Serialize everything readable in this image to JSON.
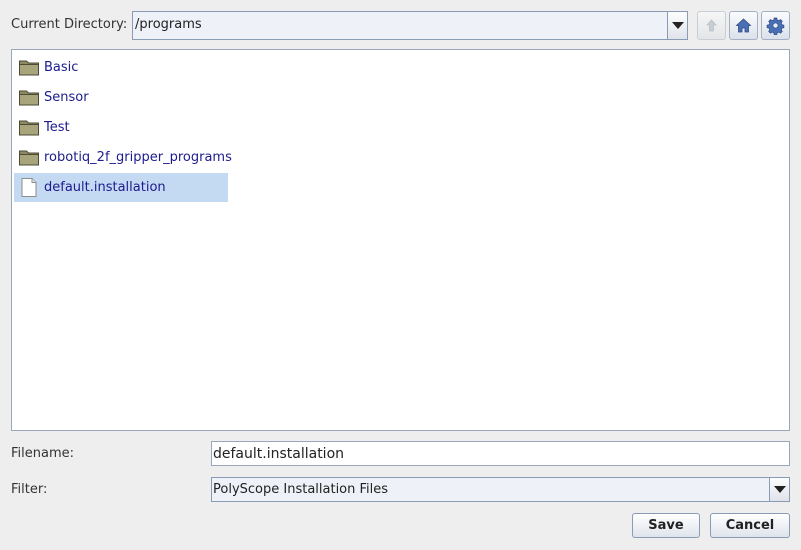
{
  "header": {
    "directory_label": "Current Directory:",
    "directory_value": "/programs",
    "up_icon": "arrow-up-icon",
    "home_icon": "home-icon",
    "settings_icon": "gear-icon"
  },
  "files": [
    {
      "name": "Basic",
      "type": "folder"
    },
    {
      "name": "Sensor",
      "type": "folder"
    },
    {
      "name": "Test",
      "type": "folder"
    },
    {
      "name": "robotiq_2f_gripper_programs",
      "type": "folder"
    },
    {
      "name": "default.installation",
      "type": "file",
      "selected": true
    }
  ],
  "filename": {
    "label": "Filename:",
    "value": "default.installation"
  },
  "filter": {
    "label": "Filter:",
    "value": "PolyScope Installation Files"
  },
  "buttons": {
    "save": "Save",
    "cancel": "Cancel"
  },
  "colors": {
    "selection": "#c4d9f2",
    "file_text": "#1c1c8e",
    "dialog_bg": "#eeeeee"
  }
}
